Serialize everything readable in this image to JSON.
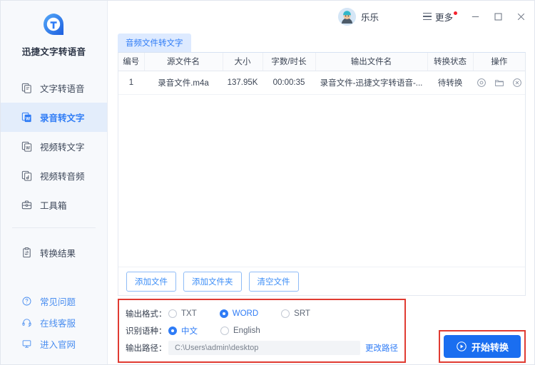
{
  "app": {
    "brand_name": "迅捷文字转语音",
    "logo_icon": "app-logo-t"
  },
  "sidebar": {
    "items": [
      {
        "label": "文字转语音",
        "icon": "text-to-speech-icon",
        "active": false
      },
      {
        "label": "录音转文字",
        "icon": "audio-to-word-icon",
        "active": true
      },
      {
        "label": "视频转文字",
        "icon": "video-to-word-icon",
        "active": false
      },
      {
        "label": "视频转音频",
        "icon": "video-to-audio-icon",
        "active": false
      },
      {
        "label": "工具箱",
        "icon": "toolbox-icon",
        "active": false
      },
      {
        "label": "转换结果",
        "icon": "clipboard-result-icon",
        "active": false
      }
    ],
    "bottom_items": [
      {
        "label": "常见问题",
        "icon": "question-circle-icon"
      },
      {
        "label": "在线客服",
        "icon": "headset-icon"
      },
      {
        "label": "进入官网",
        "icon": "monitor-icon"
      }
    ]
  },
  "titlebar": {
    "user_name": "乐乐",
    "avatar_icon": "user-avatar",
    "more_label": "更多",
    "more_badge_color": "#f5222d",
    "menu_icon": "hamburger-icon",
    "minimize_icon": "minimize-icon",
    "maximize_icon": "maximize-icon",
    "close_icon": "close-icon"
  },
  "tabs": [
    {
      "label": "音频文件转文字",
      "active": true
    }
  ],
  "table": {
    "columns": [
      "编号",
      "源文件名",
      "大小",
      "字数/时长",
      "输出文件名",
      "转换状态",
      "操作"
    ],
    "rows": [
      {
        "index": "1",
        "source_name": "录音文件.m4a",
        "size": "137.95K",
        "duration": "00:00:35",
        "output_name": "录音文件-迅捷文字转语音-...",
        "status": "待转换",
        "actions": [
          "preview-eye-icon",
          "open-folder-icon",
          "remove-circle-icon"
        ]
      }
    ]
  },
  "file_buttons": [
    {
      "label": "添加文件",
      "name": "add-file-button"
    },
    {
      "label": "添加文件夹",
      "name": "add-folder-button"
    },
    {
      "label": "清空文件",
      "name": "clear-files-button"
    }
  ],
  "settings": {
    "highlight_color": "#e03b32",
    "output_format": {
      "label": "输出格式：",
      "options": [
        {
          "label": "TXT",
          "selected": false
        },
        {
          "label": "WORD",
          "selected": true
        },
        {
          "label": "SRT",
          "selected": false
        }
      ]
    },
    "language": {
      "label": "识别语种：",
      "options": [
        {
          "label": "中文",
          "selected": true
        },
        {
          "label": "English",
          "selected": false
        }
      ]
    },
    "output_path": {
      "label": "输出路径：",
      "value": "C:\\Users\\admin\\desktop",
      "change_label": "更改路径"
    }
  },
  "cta": {
    "label": "开始转换",
    "icon": "play-circle-icon",
    "color": "#1a6ef0"
  }
}
